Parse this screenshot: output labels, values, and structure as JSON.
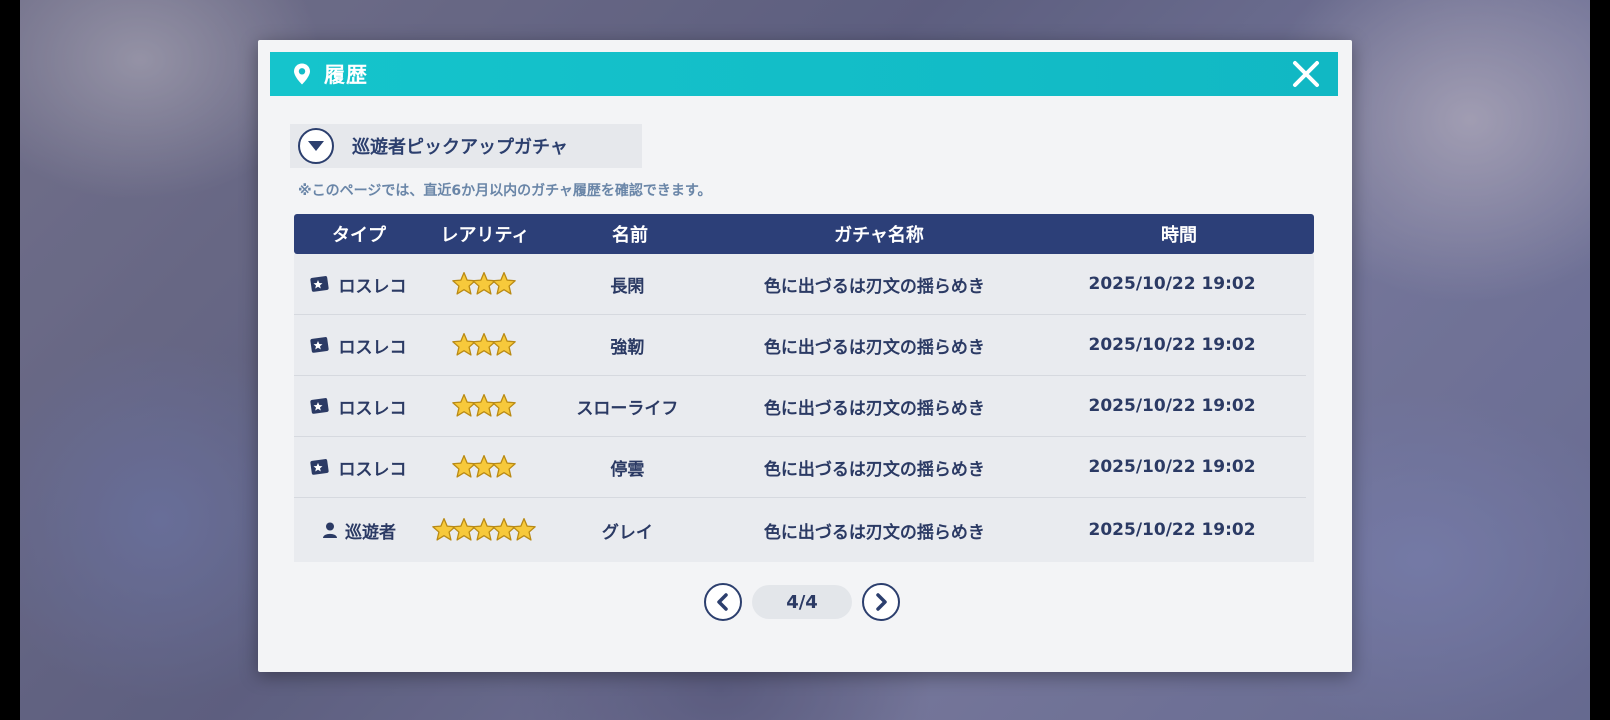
{
  "dialog": {
    "title": "履歴",
    "close_icon": "close-icon",
    "pin_icon": "location-pin-icon",
    "accent_color": "#15c4cc"
  },
  "gacha_select": {
    "label": "巡遊者ピックアップガチャ",
    "icon": "chevron-down-icon"
  },
  "notice": "※このページでは、直近6か月以内のガチャ履歴を確認できます。",
  "table": {
    "headers": [
      "タイプ",
      "レアリティ",
      "名前",
      "ガチャ名称",
      "時間"
    ],
    "header_color": "#2c3f78",
    "rows": [
      {
        "type": "ロスレコ",
        "type_icon": "record-card-icon",
        "stars": 3,
        "name": "長閑",
        "gacha": "色に出づるは刃文の揺らめき",
        "time": "2025/10/22 19:02"
      },
      {
        "type": "ロスレコ",
        "type_icon": "record-card-icon",
        "stars": 3,
        "name": "強靭",
        "gacha": "色に出づるは刃文の揺らめき",
        "time": "2025/10/22 19:02"
      },
      {
        "type": "ロスレコ",
        "type_icon": "record-card-icon",
        "stars": 3,
        "name": "スローライフ",
        "gacha": "色に出づるは刃文の揺らめき",
        "time": "2025/10/22 19:02"
      },
      {
        "type": "ロスレコ",
        "type_icon": "record-card-icon",
        "stars": 3,
        "name": "停雲",
        "gacha": "色に出づるは刃文の揺らめき",
        "time": "2025/10/22 19:02"
      },
      {
        "type": "巡遊者",
        "type_icon": "person-icon",
        "stars": 5,
        "name": "グレイ",
        "gacha": "色に出づるは刃文の揺らめき",
        "time": "2025/10/22 19:02"
      }
    ]
  },
  "pager": {
    "current": "4/4",
    "prev_icon": "chevron-left-icon",
    "next_icon": "chevron-right-icon"
  }
}
